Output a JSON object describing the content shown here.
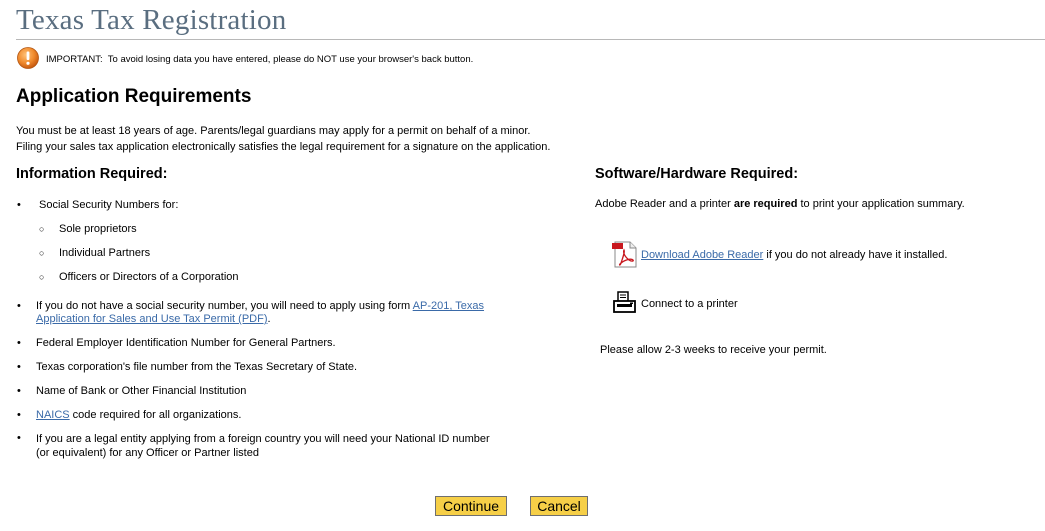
{
  "header": {
    "title": "Texas Tax Registration"
  },
  "alert": {
    "icon": "exclamation-warning-icon",
    "label": "IMPORTANT:",
    "message": "To avoid losing data you have entered, please do NOT use your browser's back button."
  },
  "main": {
    "heading": "Application Requirements",
    "intro_line1": "You must be at least 18 years of age. Parents/legal guardians may apply for a permit on behalf of a minor.",
    "intro_line2": "Filing your sales tax application electronically satisfies the legal requirement for a signature on the application."
  },
  "info": {
    "heading": "Information Required:",
    "ssn_intro": "Social Security Numbers for:",
    "ssn_items": [
      "Sole proprietors",
      "Individual Partners",
      "Officers or Directors of a Corporation"
    ],
    "no_ssn_pre": "If you do not have a social security number, you will need to apply using form",
    "no_ssn_link_line1": "AP-201, Texas",
    "no_ssn_link_line2": "Application for Sales and Use Tax Permit (PDF)",
    "no_ssn_post": ".",
    "fein": "Federal Employer Identification Number for General Partners.",
    "corp": "Texas corporation's file number from the Texas Secretary of State.",
    "bank": "Name of Bank or Other Financial Institution",
    "naics_link": "NAICS",
    "naics_rest": " code required for all organizations.",
    "foreign_line1": "If you are a legal entity applying from a foreign country you will need your National ID number",
    "foreign_line2": "(or equivalent) for any Officer or Partner listed"
  },
  "software": {
    "heading": "Software/Hardware Required:",
    "adobe_pre": "Adobe Reader and a printer ",
    "adobe_bold": "are required",
    "adobe_post": " to print your application summary.",
    "pdf_icon": "pdf-icon",
    "download_link": "Download Adobe Reader",
    "download_post": " if you do not already have it installed.",
    "printer_icon": "printer-icon",
    "printer_text": "Connect to a printer",
    "allow": "Please allow 2-3 weeks to receive your permit."
  },
  "buttons": {
    "continue_label": "Continue",
    "cancel_label": "Cancel"
  },
  "colors": {
    "title": "#5a6e80",
    "link": "#3a6aa8",
    "button": "#f6cf47",
    "alert_icon": "#e8711f"
  }
}
